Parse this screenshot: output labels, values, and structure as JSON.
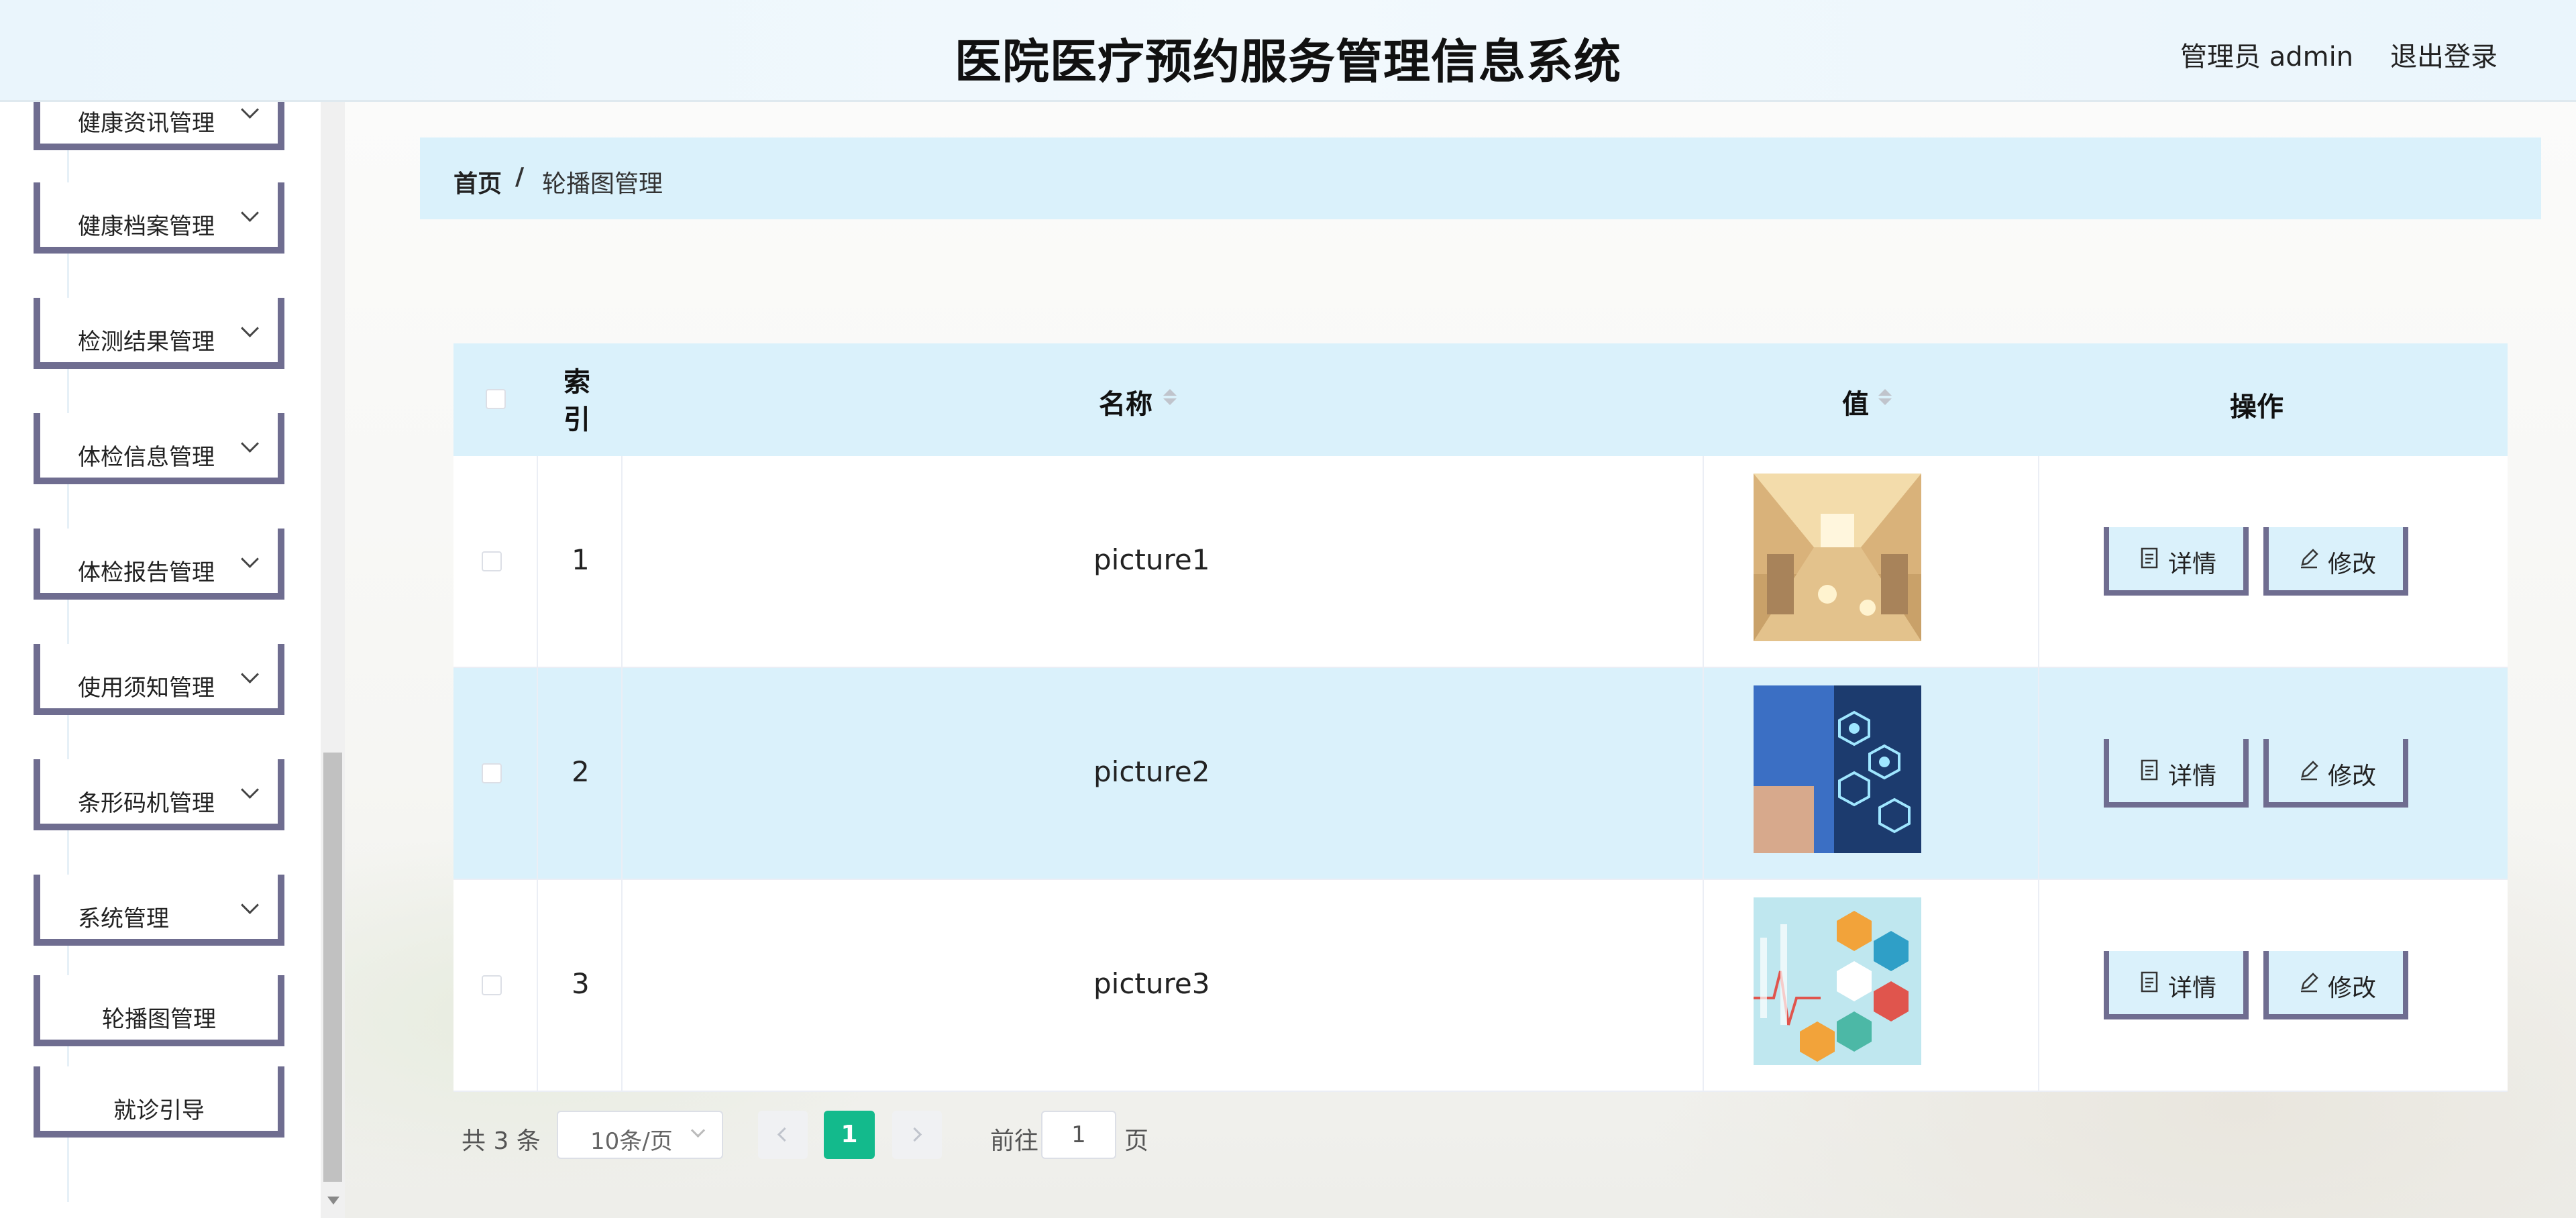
{
  "header": {
    "title": "医院医疗预约服务管理信息系统",
    "user": "管理员 admin",
    "logout": "退出登录"
  },
  "sidebar": {
    "items": [
      {
        "label": "健康资讯管理",
        "has_chevron": true
      },
      {
        "label": "健康档案管理",
        "has_chevron": true
      },
      {
        "label": "检测结果管理",
        "has_chevron": true
      },
      {
        "label": "体检信息管理",
        "has_chevron": true
      },
      {
        "label": "体检报告管理",
        "has_chevron": true
      },
      {
        "label": "使用须知管理",
        "has_chevron": true
      },
      {
        "label": "条形码机管理",
        "has_chevron": true
      },
      {
        "label": "系统管理",
        "has_chevron": true
      },
      {
        "label": "轮播图管理",
        "has_chevron": false
      },
      {
        "label": "就诊引导",
        "has_chevron": false
      }
    ]
  },
  "breadcrumb": {
    "home": "首页",
    "separator": "/",
    "current": "轮播图管理"
  },
  "table": {
    "columns": {
      "index": "索引",
      "name": "名称",
      "value": "值",
      "actions": "操作"
    },
    "rows": [
      {
        "index": "1",
        "name": "picture1",
        "image": "hospital-corridor"
      },
      {
        "index": "2",
        "name": "picture2",
        "image": "doctor-medical-icons"
      },
      {
        "index": "3",
        "name": "picture3",
        "image": "healthcare-hexagon-icons"
      }
    ],
    "detail_label": "详情",
    "edit_label": "修改"
  },
  "pagination": {
    "total": "共 3 条",
    "page_size": "10条/页",
    "current_page": "1",
    "goto_label": "前往",
    "goto_value": "1",
    "page_unit": "页"
  },
  "colors": {
    "accent_light_blue": "#daf1fb",
    "button_border": "#6f6d90",
    "page_active": "#13ba8c"
  }
}
